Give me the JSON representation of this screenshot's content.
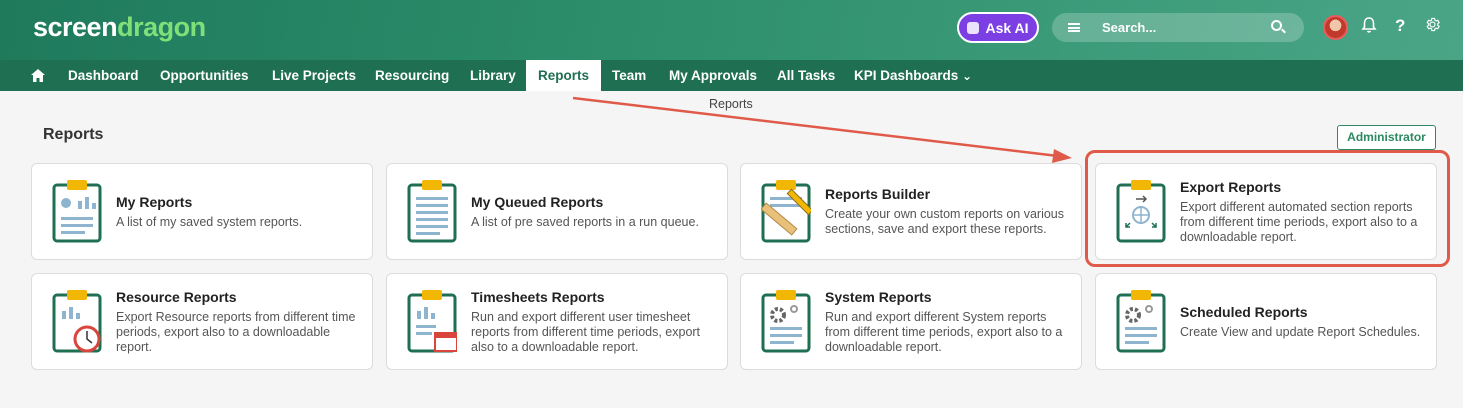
{
  "header": {
    "logo_part1": "screen",
    "logo_part2": "dragon",
    "ask_ai": "Ask AI",
    "search_placeholder": "Search..."
  },
  "nav": {
    "items": [
      "Dashboard",
      "Opportunities",
      "Live Projects",
      "Resourcing",
      "Library",
      "Reports",
      "Team",
      "My Approvals",
      "All Tasks",
      "KPI Dashboards"
    ],
    "active": "Reports",
    "dropdown_indicator": "⌄"
  },
  "breadcrumb": "Reports",
  "page": {
    "title": "Reports",
    "role_button": "Administrator"
  },
  "cards": [
    {
      "title": "My Reports",
      "desc": "A list of my saved system reports.",
      "icon": "clipboard-chart-icon"
    },
    {
      "title": "My Queued Reports",
      "desc": "A list of pre saved reports in a run queue.",
      "icon": "clipboard-list-icon"
    },
    {
      "title": "Reports Builder",
      "desc": "Create your own custom reports on various sections, save and export these reports.",
      "icon": "clipboard-pencil-icon"
    },
    {
      "title": "Export Reports",
      "desc": "Export different automated section reports from different time periods, export also to a downloadable report.",
      "icon": "clipboard-export-icon"
    },
    {
      "title": "Resource Reports",
      "desc": "Export Resource reports from different time periods, export also to a downloadable report.",
      "icon": "clipboard-clock-icon"
    },
    {
      "title": "Timesheets Reports",
      "desc": "Run and export different user timesheet reports from different time periods, export also to a downloadable report.",
      "icon": "clipboard-calendar-icon"
    },
    {
      "title": "System Reports",
      "desc": "Run and export different System reports from different time periods, export also to a downloadable report.",
      "icon": "clipboard-gear-icon"
    },
    {
      "title": "Scheduled Reports",
      "desc": "Create View and update Report Schedules.",
      "icon": "clipboard-gear-icon"
    }
  ],
  "colors": {
    "brand_green": "#1f6f52",
    "logo_accent": "#7fe07a",
    "ask_ai": "#7b3fe4",
    "highlight": "#e05a4a",
    "clipboard_clip": "#f2b705"
  }
}
